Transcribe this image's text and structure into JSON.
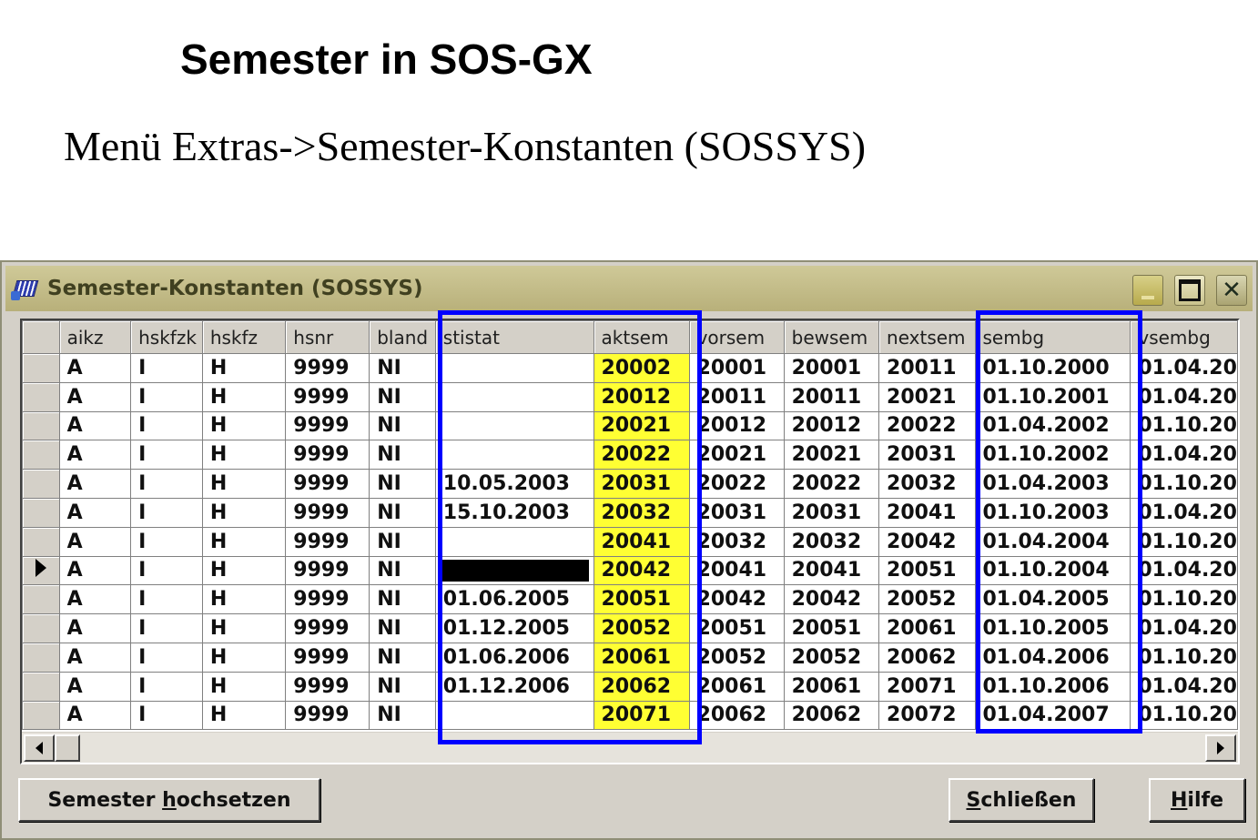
{
  "slide": {
    "title": "Semester in SOS-GX",
    "subtitle": "Menü Extras->Semester-Konstanten (SOSSYS)"
  },
  "window": {
    "title": "Semester-Konstanten (SOSSYS)",
    "app_icon": "app-icon",
    "controls": [
      "minimize-icon",
      "maximize-icon",
      "close-icon"
    ]
  },
  "table": {
    "columns": [
      "aikz",
      "hskfzk",
      "hskfz",
      "hsnr",
      "bland",
      "stistat",
      "aktsem",
      "vorsem",
      "bewsem",
      "nextsem",
      "sembg",
      "vsembg"
    ],
    "rows": [
      {
        "aikz": "A",
        "hskfzk": "I",
        "hskfz": "H",
        "hsnr": "9999",
        "bland": "NI",
        "stistat": "",
        "aktsem": "20002",
        "vorsem": "20001",
        "bewsem": "20001",
        "nextsem": "20011",
        "sembg": "01.10.2000",
        "vsembg": "01.04.20"
      },
      {
        "aikz": "A",
        "hskfzk": "I",
        "hskfz": "H",
        "hsnr": "9999",
        "bland": "NI",
        "stistat": "",
        "aktsem": "20012",
        "vorsem": "20011",
        "bewsem": "20011",
        "nextsem": "20021",
        "sembg": "01.10.2001",
        "vsembg": "01.04.20"
      },
      {
        "aikz": "A",
        "hskfzk": "I",
        "hskfz": "H",
        "hsnr": "9999",
        "bland": "NI",
        "stistat": "",
        "aktsem": "20021",
        "vorsem": "20012",
        "bewsem": "20012",
        "nextsem": "20022",
        "sembg": "01.04.2002",
        "vsembg": "01.10.20"
      },
      {
        "aikz": "A",
        "hskfzk": "I",
        "hskfz": "H",
        "hsnr": "9999",
        "bland": "NI",
        "stistat": "",
        "aktsem": "20022",
        "vorsem": "20021",
        "bewsem": "20021",
        "nextsem": "20031",
        "sembg": "01.10.2002",
        "vsembg": "01.04.20"
      },
      {
        "aikz": "A",
        "hskfzk": "I",
        "hskfz": "H",
        "hsnr": "9999",
        "bland": "NI",
        "stistat": "10.05.2003",
        "aktsem": "20031",
        "vorsem": "20022",
        "bewsem": "20022",
        "nextsem": "20032",
        "sembg": "01.04.2003",
        "vsembg": "01.10.20"
      },
      {
        "aikz": "A",
        "hskfzk": "I",
        "hskfz": "H",
        "hsnr": "9999",
        "bland": "NI",
        "stistat": "15.10.2003",
        "aktsem": "20032",
        "vorsem": "20031",
        "bewsem": "20031",
        "nextsem": "20041",
        "sembg": "01.10.2003",
        "vsembg": "01.04.20"
      },
      {
        "aikz": "A",
        "hskfzk": "I",
        "hskfz": "H",
        "hsnr": "9999",
        "bland": "NI",
        "stistat": "",
        "aktsem": "20041",
        "vorsem": "20032",
        "bewsem": "20032",
        "nextsem": "20042",
        "sembg": "01.04.2004",
        "vsembg": "01.10.20"
      },
      {
        "aikz": "A",
        "hskfzk": "I",
        "hskfz": "H",
        "hsnr": "9999",
        "bland": "NI",
        "stistat": "",
        "aktsem": "20042",
        "vorsem": "20041",
        "bewsem": "20041",
        "nextsem": "20051",
        "sembg": "01.10.2004",
        "vsembg": "01.04.20",
        "current": true,
        "stistat_redacted": true
      },
      {
        "aikz": "A",
        "hskfzk": "I",
        "hskfz": "H",
        "hsnr": "9999",
        "bland": "NI",
        "stistat": "01.06.2005",
        "aktsem": "20051",
        "vorsem": "20042",
        "bewsem": "20042",
        "nextsem": "20052",
        "sembg": "01.04.2005",
        "vsembg": "01.10.20"
      },
      {
        "aikz": "A",
        "hskfzk": "I",
        "hskfz": "H",
        "hsnr": "9999",
        "bland": "NI",
        "stistat": "01.12.2005",
        "aktsem": "20052",
        "vorsem": "20051",
        "bewsem": "20051",
        "nextsem": "20061",
        "sembg": "01.10.2005",
        "vsembg": "01.04.20"
      },
      {
        "aikz": "A",
        "hskfzk": "I",
        "hskfz": "H",
        "hsnr": "9999",
        "bland": "NI",
        "stistat": "01.06.2006",
        "aktsem": "20061",
        "vorsem": "20052",
        "bewsem": "20052",
        "nextsem": "20062",
        "sembg": "01.04.2006",
        "vsembg": "01.10.20"
      },
      {
        "aikz": "A",
        "hskfzk": "I",
        "hskfz": "H",
        "hsnr": "9999",
        "bland": "NI",
        "stistat": "01.12.2006",
        "aktsem": "20062",
        "vorsem": "20061",
        "bewsem": "20061",
        "nextsem": "20071",
        "sembg": "01.10.2006",
        "vsembg": "01.04.20"
      },
      {
        "aikz": "A",
        "hskfzk": "I",
        "hskfz": "H",
        "hsnr": "9999",
        "bland": "NI",
        "stistat": "",
        "aktsem": "20071",
        "vorsem": "20062",
        "bewsem": "20062",
        "nextsem": "20072",
        "sembg": "01.04.2007",
        "vsembg": "01.10.20"
      }
    ],
    "highlight_column": "aktsem",
    "highlight_color": "#ffff33",
    "annotation_color": "#0000ff"
  },
  "buttons": {
    "semester_pre": "Semester ",
    "semester_u": "h",
    "semester_post": "ochsetzen",
    "close_u": "S",
    "close_post": "chließen",
    "help_u": "H",
    "help_post": "ilfe"
  }
}
